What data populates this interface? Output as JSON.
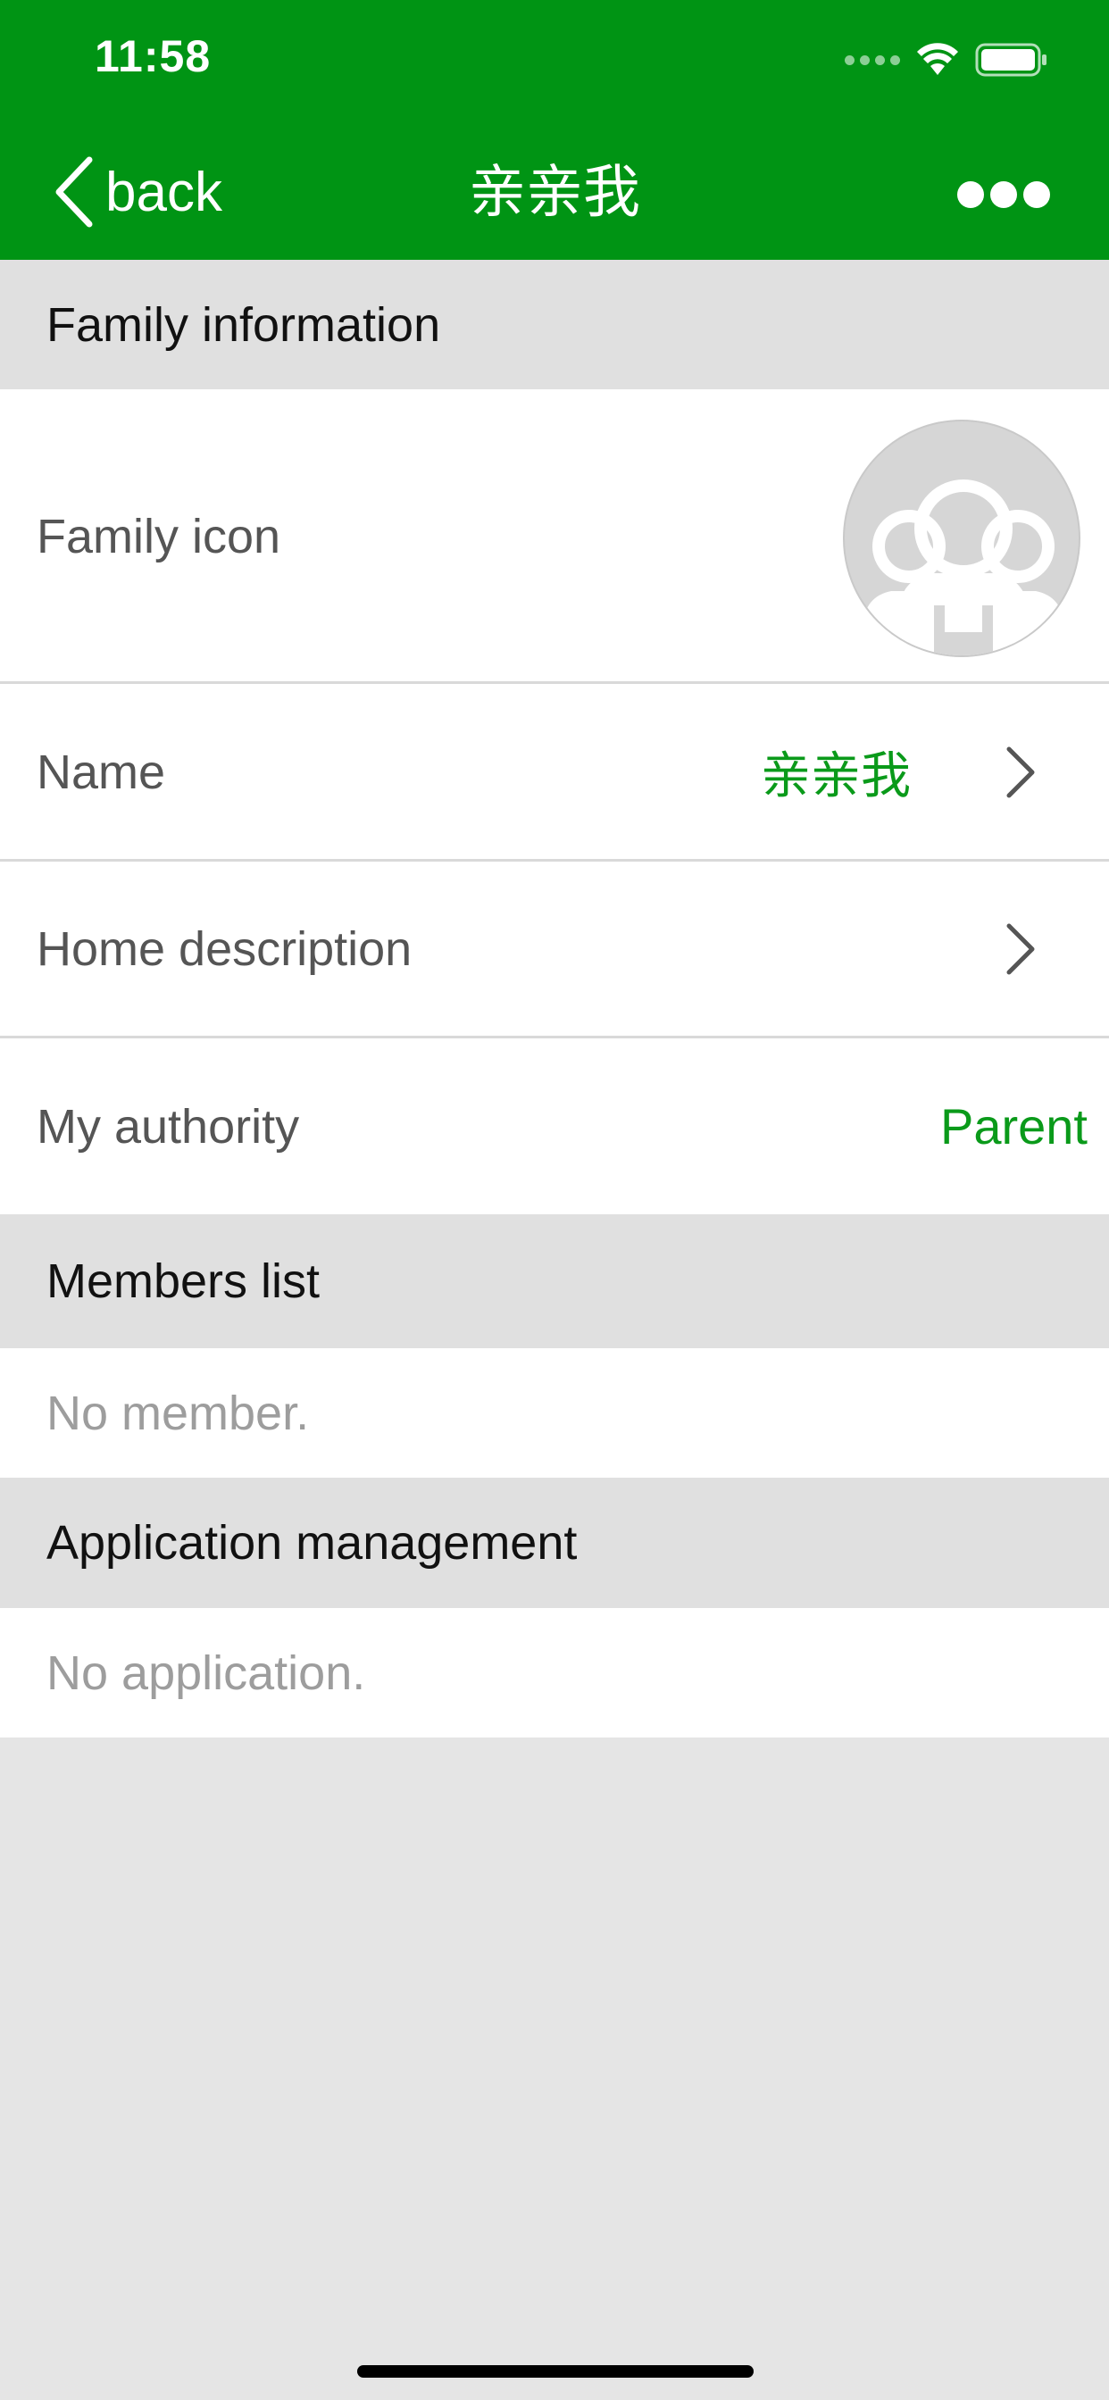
{
  "status_bar": {
    "time": "11:58"
  },
  "nav": {
    "back_label": "back",
    "title": "亲亲我"
  },
  "sections": {
    "family_info": "Family information",
    "members": "Members list",
    "applications": "Application management"
  },
  "rows": {
    "family_icon": {
      "label": "Family icon"
    },
    "name": {
      "label": "Name",
      "value": "亲亲我"
    },
    "description": {
      "label": "Home description"
    },
    "authority": {
      "label": "My authority",
      "value": "Parent"
    }
  },
  "members": {
    "empty_text": "No member."
  },
  "applications": {
    "empty_text": "No application."
  },
  "colors": {
    "header_green": "#009414",
    "accent_green": "#0a9a1a",
    "section_bg": "#e0e0e0",
    "page_bg": "#e5e5e5"
  }
}
